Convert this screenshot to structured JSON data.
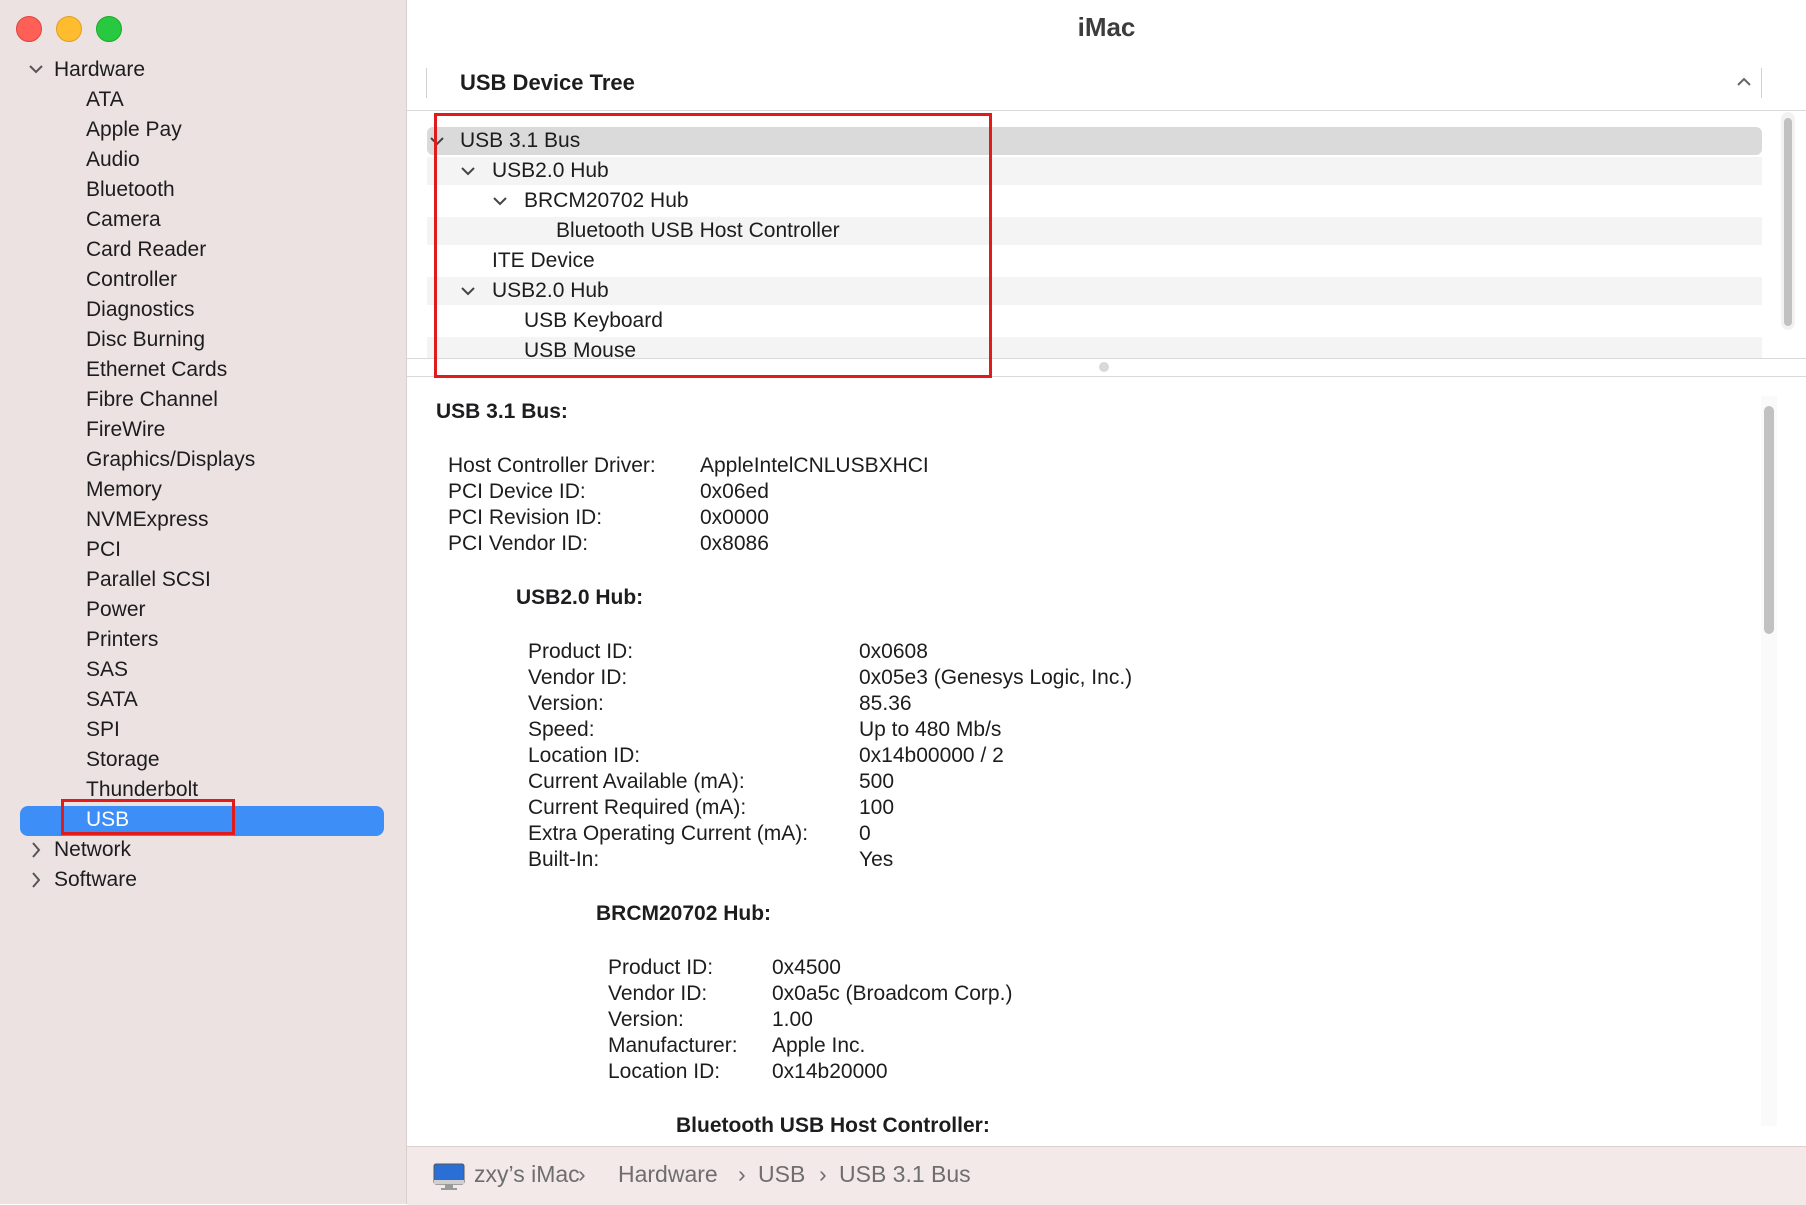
{
  "window": {
    "title": "iMac"
  },
  "sidebar": {
    "hardware_label": "Hardware",
    "hardware_items": [
      "ATA",
      "Apple Pay",
      "Audio",
      "Bluetooth",
      "Camera",
      "Card Reader",
      "Controller",
      "Diagnostics",
      "Disc Burning",
      "Ethernet Cards",
      "Fibre Channel",
      "FireWire",
      "Graphics/Displays",
      "Memory",
      "NVMExpress",
      "PCI",
      "Parallel SCSI",
      "Power",
      "Printers",
      "SAS",
      "SATA",
      "SPI",
      "Storage",
      "Thunderbolt",
      "USB"
    ],
    "selected_item": "USB",
    "network_label": "Network",
    "software_label": "Software",
    "selection_color": "#3d8ef7"
  },
  "tree": {
    "header": "USB Device Tree",
    "rows": [
      {
        "label": "USB 3.1 Bus"
      },
      {
        "label": "USB2.0 Hub"
      },
      {
        "label": "BRCM20702 Hub"
      },
      {
        "label": "Bluetooth USB Host Controller"
      },
      {
        "label": "ITE Device"
      },
      {
        "label": "USB2.0 Hub"
      },
      {
        "label": "USB Keyboard"
      },
      {
        "label": "USB Mouse"
      }
    ]
  },
  "detail": {
    "bus_title": "USB 3.1 Bus:",
    "bus_props": [
      {
        "k": "Host Controller Driver:",
        "v": "AppleIntelCNLUSBXHCI"
      },
      {
        "k": "PCI Device ID:",
        "v": "0x06ed"
      },
      {
        "k": "PCI Revision ID:",
        "v": "0x0000"
      },
      {
        "k": "PCI Vendor ID:",
        "v": "0x8086"
      }
    ],
    "hub_title": "USB2.0 Hub:",
    "hub_props": [
      {
        "k": "Product ID:",
        "v": "0x0608"
      },
      {
        "k": "Vendor ID:",
        "v": "0x05e3  (Genesys Logic, Inc.)"
      },
      {
        "k": "Version:",
        "v": "85.36"
      },
      {
        "k": "Speed:",
        "v": "Up to 480 Mb/s"
      },
      {
        "k": "Location ID:",
        "v": "0x14b00000 / 2"
      },
      {
        "k": "Current Available (mA):",
        "v": "500"
      },
      {
        "k": "Current Required (mA):",
        "v": "100"
      },
      {
        "k": "Extra Operating Current (mA):",
        "v": "0"
      },
      {
        "k": "Built-In:",
        "v": "Yes"
      }
    ],
    "brcm_title": "BRCM20702 Hub:",
    "brcm_props": [
      {
        "k": "Product ID:",
        "v": "0x4500"
      },
      {
        "k": "Vendor ID:",
        "v": "0x0a5c  (Broadcom Corp.)"
      },
      {
        "k": "Version:",
        "v": "1.00"
      },
      {
        "k": "Manufacturer:",
        "v": "Apple Inc."
      },
      {
        "k": "Location ID:",
        "v": "0x14b20000"
      }
    ],
    "bt_title": "Bluetooth USB Host Controller:"
  },
  "pathbar": {
    "computer": "zxy’s iMac",
    "sep": "›",
    "hardware": "Hardware",
    "usb": "USB",
    "bus": "USB 3.1 Bus"
  },
  "highlight_color": "#e01b1b"
}
